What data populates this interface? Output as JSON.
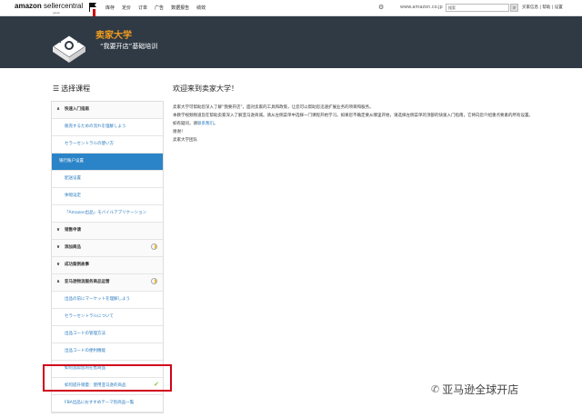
{
  "topnav": {
    "logo_main": "amazon",
    "logo_rest": " sellercentral",
    "logo_sub": "japan",
    "links": [
      "库存",
      "定价",
      "订单",
      "广告",
      "数据报告",
      "绩效"
    ],
    "site": "www.amazon.co.jp",
    "search_placeholder": "搜索",
    "right_links": "买家信息 | 帮助 | 设置"
  },
  "banner": {
    "title": "卖家大学",
    "subtitle": "“我要开店”基础培训"
  },
  "sidebar": {
    "heading": "选择课程",
    "items": [
      {
        "label": "快速入门指南",
        "kind": "sec",
        "arrow": "∧"
      },
      {
        "label": "販売するための流れを理解しよう",
        "kind": "sub"
      },
      {
        "label": "セラーセントラルの使い方",
        "kind": "sub"
      },
      {
        "label": "银行账户设置",
        "kind": "active"
      },
      {
        "label": "配送设置",
        "kind": "sub"
      },
      {
        "label": "休暇设定",
        "kind": "sub"
      },
      {
        "label": "「Amazon出品」モバイルアプリケーション",
        "kind": "sub"
      },
      {
        "label": "销售申请",
        "kind": "sec",
        "arrow": "∨"
      },
      {
        "label": "添加商品",
        "kind": "sec",
        "arrow": "∨",
        "progress": true
      },
      {
        "label": "成功案例故事",
        "kind": "sec",
        "arrow": "∨"
      },
      {
        "label": "亚马逊物流服务商品运营",
        "kind": "sec",
        "arrow": "∧",
        "progress": true
      },
      {
        "label": "出品の前にマーケットを理解しよう",
        "kind": "sub"
      },
      {
        "label": "セラーセントラルについて",
        "kind": "sub"
      },
      {
        "label": "出品コードの管理方法",
        "kind": "sub"
      },
      {
        "label": "出品コードの便利機能",
        "kind": "sub"
      },
      {
        "label": "如何追踪您的在售商品",
        "kind": "sub"
      },
      {
        "label": "如何提升销量：使用亚马逊的商品",
        "kind": "sub",
        "check": true
      },
      {
        "label": "FBA出品におすすめテーマ別商品一覧",
        "kind": "sub"
      }
    ]
  },
  "main": {
    "title": "欢迎来到卖家大学！",
    "p1": "卖家大学可帮助您深入了解“我要开店”，面对卖家的工具和政策，让您可以帮助您迅速扩展业务的项目和服务。",
    "p2": "本教学视频频道旨在帮助卖家深入了解亚马逊商城。请从左侧菜单中选择一门课程开始学习。如果您不确定要从哪里开始，请选择左侧菜单的顶部的快速入门指南，它将向您介绍重点要素的所有设置。",
    "p3_prefix": "如有疑问，请",
    "p3_link": "联系我们",
    "p3_suffix": "。",
    "p4": "谢谢！",
    "p5": "卖家大学团队"
  },
  "watermark": {
    "text": "亚马逊全球开店"
  }
}
